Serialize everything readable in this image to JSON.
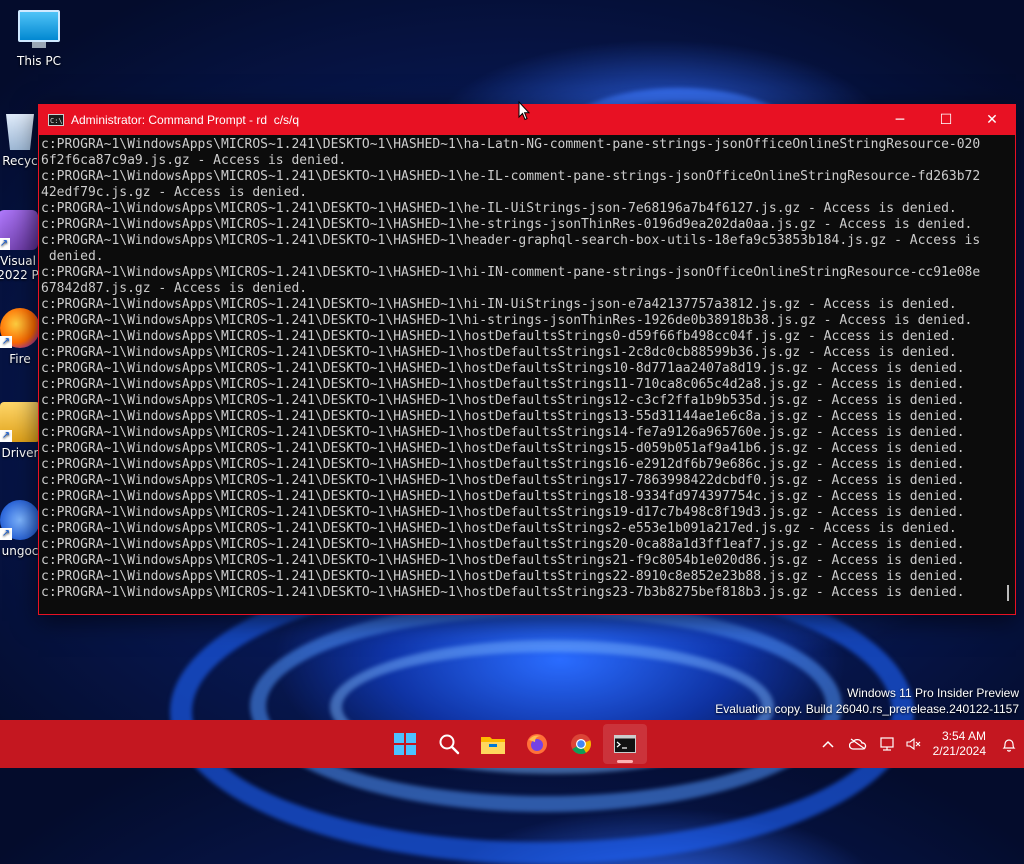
{
  "desktop": {
    "icons": [
      {
        "label": "This PC",
        "icon": "monitor-icon"
      },
      {
        "label": "Recyc",
        "icon": "recycle-bin-icon"
      },
      {
        "label": "Visual",
        "label2": "2022 P",
        "icon": "visual-studio-icon"
      },
      {
        "label": "Fire",
        "icon": "firefox-icon"
      },
      {
        "label": "Driver",
        "icon": "driver-icon"
      },
      {
        "label": "ungoc",
        "icon": "app-icon"
      }
    ]
  },
  "window": {
    "title": "Administrator: Command Prompt - rd  c/s/q",
    "controls": {
      "minimize": "─",
      "maximize": "☐",
      "close": "✕"
    },
    "lines": [
      "c:PROGRA~1\\WindowsApps\\MICROS~1.241\\DESKTO~1\\HASHED~1\\ha-Latn-NG-comment-pane-strings-jsonOfficeOnlineStringResource-020",
      "6f2f6ca87c9a9.js.gz - Access is denied.",
      "c:PROGRA~1\\WindowsApps\\MICROS~1.241\\DESKTO~1\\HASHED~1\\he-IL-comment-pane-strings-jsonOfficeOnlineStringResource-fd263b72",
      "42edf79c.js.gz - Access is denied.",
      "c:PROGRA~1\\WindowsApps\\MICROS~1.241\\DESKTO~1\\HASHED~1\\he-IL-UiStrings-json-7e68196a7b4f6127.js.gz - Access is denied.",
      "c:PROGRA~1\\WindowsApps\\MICROS~1.241\\DESKTO~1\\HASHED~1\\he-strings-jsonThinRes-0196d9ea202da0aa.js.gz - Access is denied.",
      "c:PROGRA~1\\WindowsApps\\MICROS~1.241\\DESKTO~1\\HASHED~1\\header-graphql-search-box-utils-18efa9c53853b184.js.gz - Access is",
      " denied.",
      "c:PROGRA~1\\WindowsApps\\MICROS~1.241\\DESKTO~1\\HASHED~1\\hi-IN-comment-pane-strings-jsonOfficeOnlineStringResource-cc91e08e",
      "67842d87.js.gz - Access is denied.",
      "c:PROGRA~1\\WindowsApps\\MICROS~1.241\\DESKTO~1\\HASHED~1\\hi-IN-UiStrings-json-e7a42137757a3812.js.gz - Access is denied.",
      "c:PROGRA~1\\WindowsApps\\MICROS~1.241\\DESKTO~1\\HASHED~1\\hi-strings-jsonThinRes-1926de0b38918b38.js.gz - Access is denied.",
      "c:PROGRA~1\\WindowsApps\\MICROS~1.241\\DESKTO~1\\HASHED~1\\hostDefaultsStrings0-d59f66fb498cc04f.js.gz - Access is denied.",
      "c:PROGRA~1\\WindowsApps\\MICROS~1.241\\DESKTO~1\\HASHED~1\\hostDefaultsStrings1-2c8dc0cb88599b36.js.gz - Access is denied.",
      "c:PROGRA~1\\WindowsApps\\MICROS~1.241\\DESKTO~1\\HASHED~1\\hostDefaultsStrings10-8d771aa2407a8d19.js.gz - Access is denied.",
      "c:PROGRA~1\\WindowsApps\\MICROS~1.241\\DESKTO~1\\HASHED~1\\hostDefaultsStrings11-710ca8c065c4d2a8.js.gz - Access is denied.",
      "c:PROGRA~1\\WindowsApps\\MICROS~1.241\\DESKTO~1\\HASHED~1\\hostDefaultsStrings12-c3cf2ffa1b9b535d.js.gz - Access is denied.",
      "c:PROGRA~1\\WindowsApps\\MICROS~1.241\\DESKTO~1\\HASHED~1\\hostDefaultsStrings13-55d31144ae1e6c8a.js.gz - Access is denied.",
      "c:PROGRA~1\\WindowsApps\\MICROS~1.241\\DESKTO~1\\HASHED~1\\hostDefaultsStrings14-fe7a9126a965760e.js.gz - Access is denied.",
      "c:PROGRA~1\\WindowsApps\\MICROS~1.241\\DESKTO~1\\HASHED~1\\hostDefaultsStrings15-d059b051af9a41b6.js.gz - Access is denied.",
      "c:PROGRA~1\\WindowsApps\\MICROS~1.241\\DESKTO~1\\HASHED~1\\hostDefaultsStrings16-e2912df6b79e686c.js.gz - Access is denied.",
      "c:PROGRA~1\\WindowsApps\\MICROS~1.241\\DESKTO~1\\HASHED~1\\hostDefaultsStrings17-7863998422dcbdf0.js.gz - Access is denied.",
      "c:PROGRA~1\\WindowsApps\\MICROS~1.241\\DESKTO~1\\HASHED~1\\hostDefaultsStrings18-9334fd974397754c.js.gz - Access is denied.",
      "c:PROGRA~1\\WindowsApps\\MICROS~1.241\\DESKTO~1\\HASHED~1\\hostDefaultsStrings19-d17c7b498c8f19d3.js.gz - Access is denied.",
      "c:PROGRA~1\\WindowsApps\\MICROS~1.241\\DESKTO~1\\HASHED~1\\hostDefaultsStrings2-e553e1b091a217ed.js.gz - Access is denied.",
      "c:PROGRA~1\\WindowsApps\\MICROS~1.241\\DESKTO~1\\HASHED~1\\hostDefaultsStrings20-0ca88a1d3ff1eaf7.js.gz - Access is denied.",
      "c:PROGRA~1\\WindowsApps\\MICROS~1.241\\DESKTO~1\\HASHED~1\\hostDefaultsStrings21-f9c8054b1e020d86.js.gz - Access is denied.",
      "c:PROGRA~1\\WindowsApps\\MICROS~1.241\\DESKTO~1\\HASHED~1\\hostDefaultsStrings22-8910c8e852e23b88.js.gz - Access is denied.",
      "c:PROGRA~1\\WindowsApps\\MICROS~1.241\\DESKTO~1\\HASHED~1\\hostDefaultsStrings23-7b3b8275bef818b3.js.gz - Access is denied."
    ]
  },
  "watermark": {
    "line1": "Windows 11 Pro Insider Preview",
    "line2": "Evaluation copy. Build 26040.rs_prerelease.240122-1157"
  },
  "taskbar": {
    "apps": [
      "start-icon",
      "search-icon",
      "file-explorer-icon",
      "firefox-icon",
      "chrome-icon",
      "command-prompt-icon"
    ],
    "tray": {
      "time": "3:54 AM",
      "date": "2/21/2024"
    }
  },
  "colors": {
    "accent": "#e81123",
    "taskbar": "#c41720",
    "console_bg": "#0c0c0c",
    "console_text": "#cccccc"
  }
}
